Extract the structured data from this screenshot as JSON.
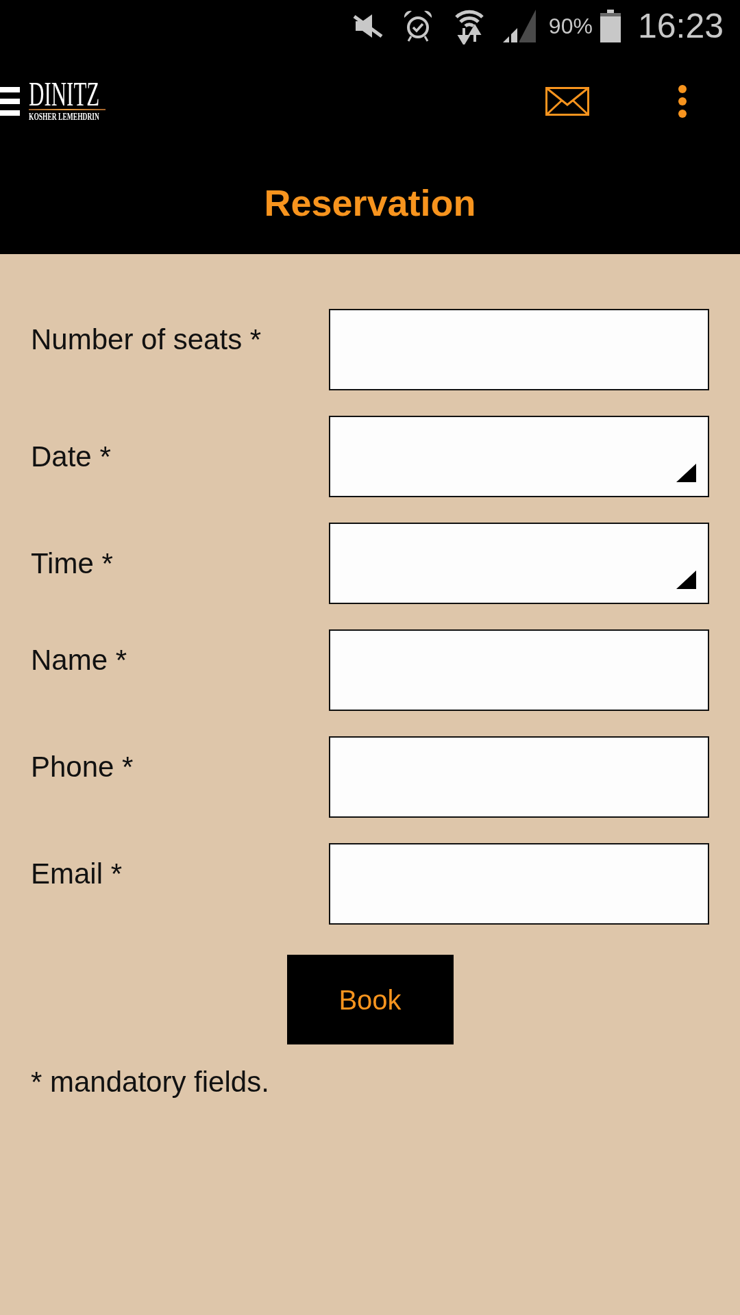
{
  "status_bar": {
    "battery": "90%",
    "time": "16:23"
  },
  "app_bar": {
    "logo_name": "DINITZ",
    "logo_tagline": "KOSHER LEMEHDRIN",
    "title": "Reservation"
  },
  "form": {
    "fields": [
      {
        "label": "Number of seats *",
        "kind": "text"
      },
      {
        "label": "Date *",
        "kind": "select"
      },
      {
        "label": "Time *",
        "kind": "select"
      },
      {
        "label": "Name *",
        "kind": "text"
      },
      {
        "label": "Phone *",
        "kind": "text"
      },
      {
        "label": "Email *",
        "kind": "text"
      }
    ],
    "submit_button": "Book",
    "footnote": "* mandatory fields."
  }
}
